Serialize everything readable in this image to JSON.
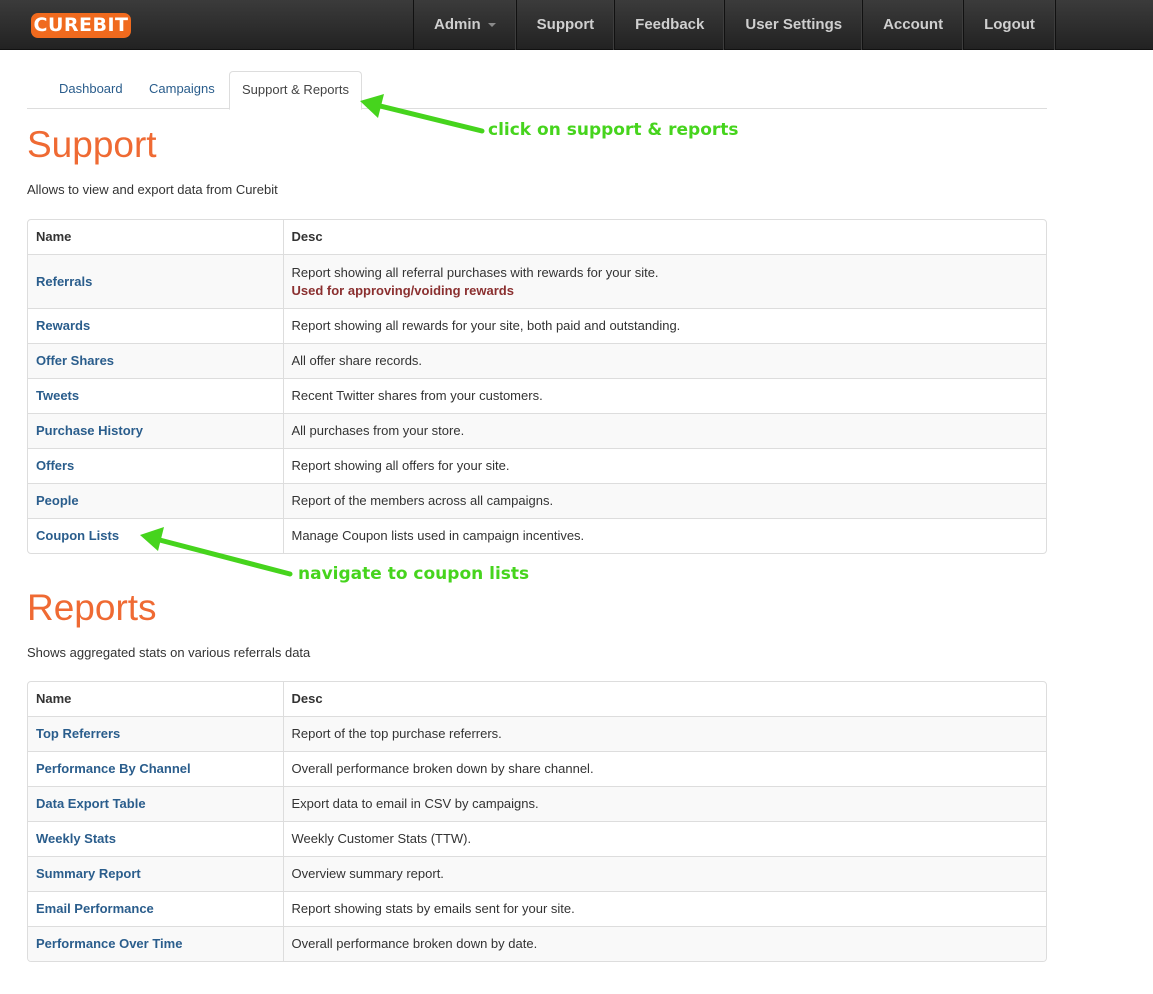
{
  "navbar": {
    "logo": "CUREBIT",
    "items": [
      {
        "label": "Admin",
        "dropdown": true
      },
      {
        "label": "Support"
      },
      {
        "label": "Feedback"
      },
      {
        "label": "User Settings"
      },
      {
        "label": "Account"
      },
      {
        "label": "Logout"
      }
    ]
  },
  "tabs": [
    {
      "label": "Dashboard",
      "active": false
    },
    {
      "label": "Campaigns",
      "active": false
    },
    {
      "label": "Support & Reports",
      "active": true
    }
  ],
  "support": {
    "title": "Support",
    "subtitle": "Allows to view and export data from Curebit",
    "columns": [
      "Name",
      "Desc"
    ],
    "rows": [
      {
        "name": "Referrals",
        "desc": "Report showing all referral purchases with rewards for your site.",
        "note": "Used for approving/voiding rewards"
      },
      {
        "name": "Rewards",
        "desc": "Report showing all rewards for your site, both paid and outstanding."
      },
      {
        "name": "Offer Shares",
        "desc": "All offer share records."
      },
      {
        "name": "Tweets",
        "desc": "Recent Twitter shares from your customers."
      },
      {
        "name": "Purchase History",
        "desc": "All purchases from your store."
      },
      {
        "name": "Offers",
        "desc": "Report showing all offers for your site."
      },
      {
        "name": "People",
        "desc": "Report of the members across all campaigns."
      },
      {
        "name": "Coupon Lists",
        "desc": "Manage Coupon lists used in campaign incentives."
      }
    ]
  },
  "reports": {
    "title": "Reports",
    "subtitle": "Shows aggregated stats on various referrals data",
    "columns": [
      "Name",
      "Desc"
    ],
    "rows": [
      {
        "name": "Top Referrers",
        "desc": "Report of the top purchase referrers."
      },
      {
        "name": "Performance By Channel",
        "desc": "Overall performance broken down by share channel."
      },
      {
        "name": "Data Export Table",
        "desc": "Export data to email in CSV by campaigns."
      },
      {
        "name": "Weekly Stats",
        "desc": "Weekly Customer Stats (TTW)."
      },
      {
        "name": "Summary Report",
        "desc": "Overview summary report."
      },
      {
        "name": "Email Performance",
        "desc": "Report showing stats by emails sent for your site."
      },
      {
        "name": "Performance Over Time",
        "desc": "Overall performance broken down by date."
      }
    ]
  },
  "annotations": {
    "tab_hint": "click on support & reports",
    "coupon_hint": "navigate to coupon lists",
    "color": "#46d41d"
  },
  "colors": {
    "accent": "#ef6a33",
    "link": "#2a5d8c",
    "logo_bg": "#f06a1e"
  }
}
